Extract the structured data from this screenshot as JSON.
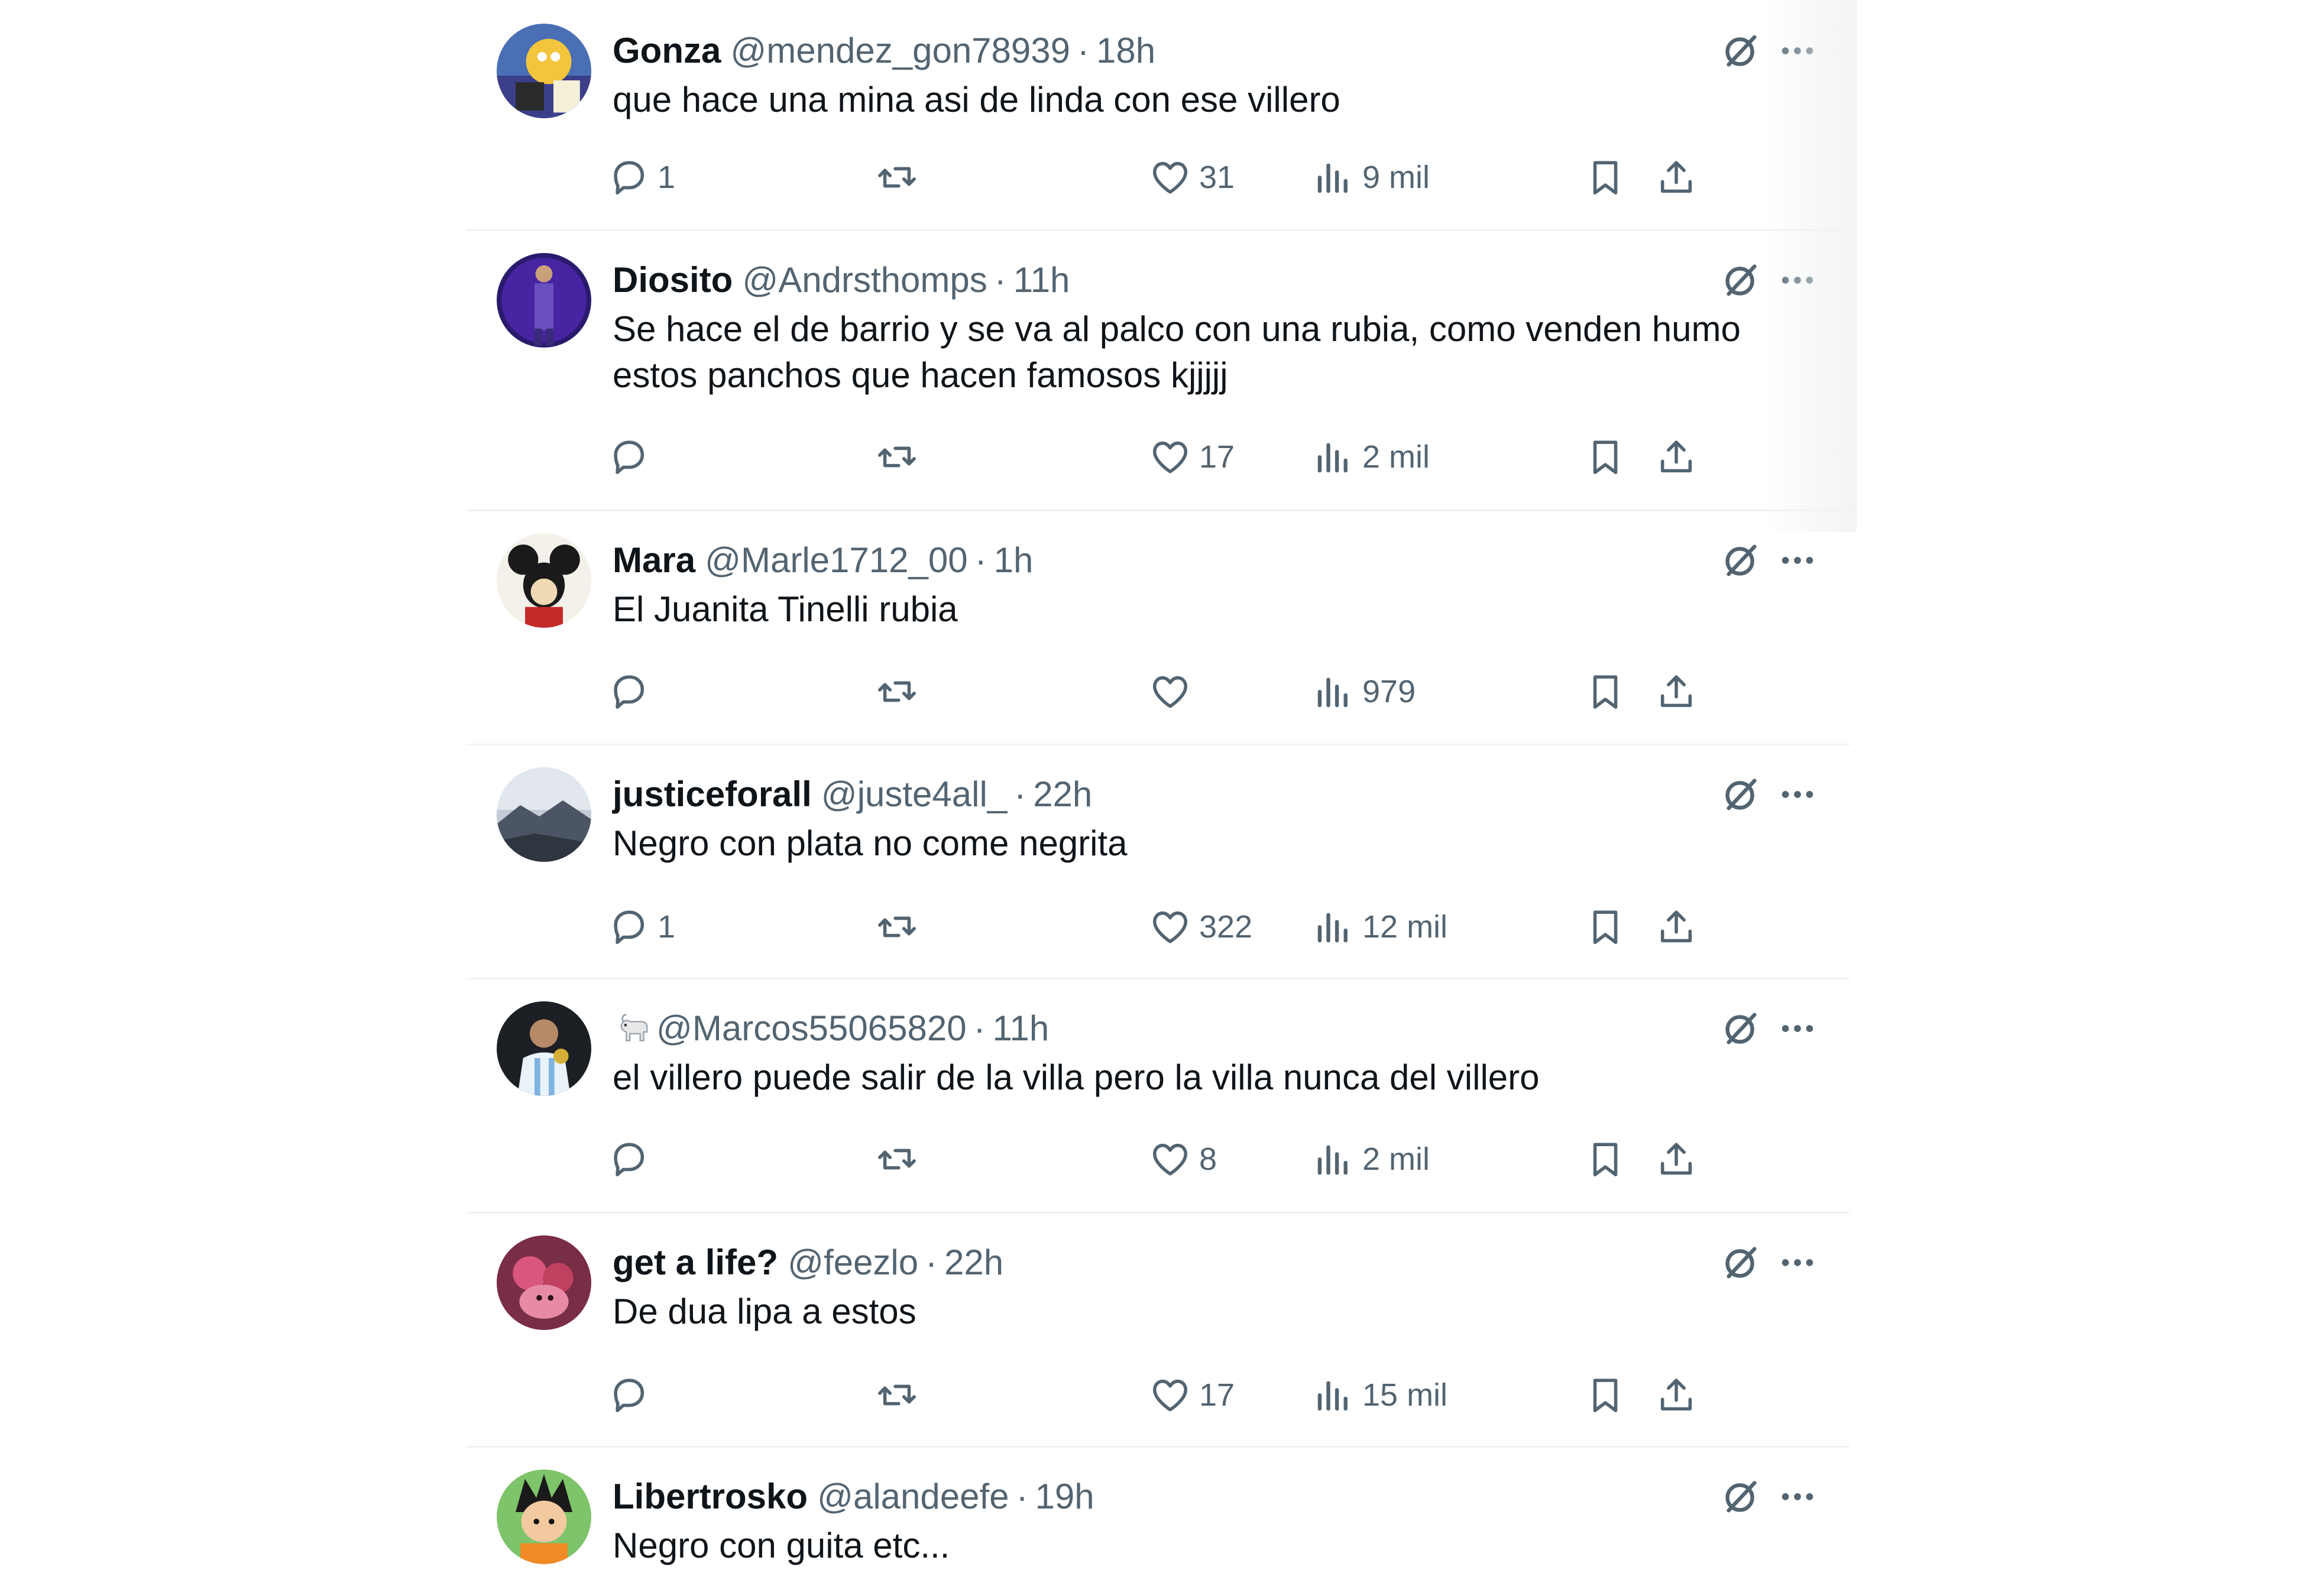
{
  "replies": [
    {
      "name": "Gonza",
      "handle": "@mendez_gon78939",
      "sep": "·",
      "time": "18h",
      "text": "que hace una mina asi de linda con ese villero",
      "replies": "1",
      "likes": "31",
      "views": "9 mil",
      "avatar": "cartoon-avatar"
    },
    {
      "name": "Diosito",
      "handle": "@Andrsthomps",
      "sep": "·",
      "time": "11h",
      "text": "Se hace el de barrio y se va al palco con una rubia, como venden humo estos panchos que hacen famosos kjjjjj",
      "replies": "",
      "likes": "17",
      "views": "2 mil",
      "avatar": "stage-avatar"
    },
    {
      "name": "Mara",
      "handle": "@Marle1712_00",
      "sep": "·",
      "time": "1h",
      "text": "El Juanita Tinelli rubia",
      "replies": "",
      "likes": "",
      "views": "979",
      "avatar": "mouse-avatar"
    },
    {
      "name": "justiceforall",
      "handle": "@juste4all_",
      "sep": "·",
      "time": "22h",
      "text": "Negro con plata no come negrita",
      "replies": "1",
      "likes": "322",
      "views": "12 mil",
      "avatar": "sky-avatar"
    },
    {
      "name": "",
      "emoji": "goat-emoji",
      "handle": "@Marcos55065820",
      "sep": "·",
      "time": "11h",
      "text": "el villero puede salir de la villa pero la villa nunca del villero",
      "replies": "",
      "likes": "8",
      "views": "2 mil",
      "avatar": "player-avatar"
    },
    {
      "name": "get a life?",
      "handle": "@feezlo",
      "sep": "·",
      "time": "22h",
      "text": "De dua lipa a estos",
      "replies": "",
      "likes": "17",
      "views": "15 mil",
      "avatar": "pink-avatar"
    },
    {
      "name": "Libertrosko",
      "handle": "@alandeefe",
      "sep": "·",
      "time": "19h",
      "text": "Negro con guita etc...",
      "avatar": "anime-avatar"
    }
  ],
  "icons": {
    "grok": "grok-icon",
    "more": "more-icon",
    "reply": "reply-icon",
    "retweet": "retweet-icon",
    "like": "like-icon",
    "views": "views-icon",
    "bookmark": "bookmark-icon",
    "share": "share-icon"
  },
  "colors": {
    "text": "#0f1419",
    "muted": "#536471",
    "divider": "#eff3f4",
    "background": "#ffffff"
  }
}
